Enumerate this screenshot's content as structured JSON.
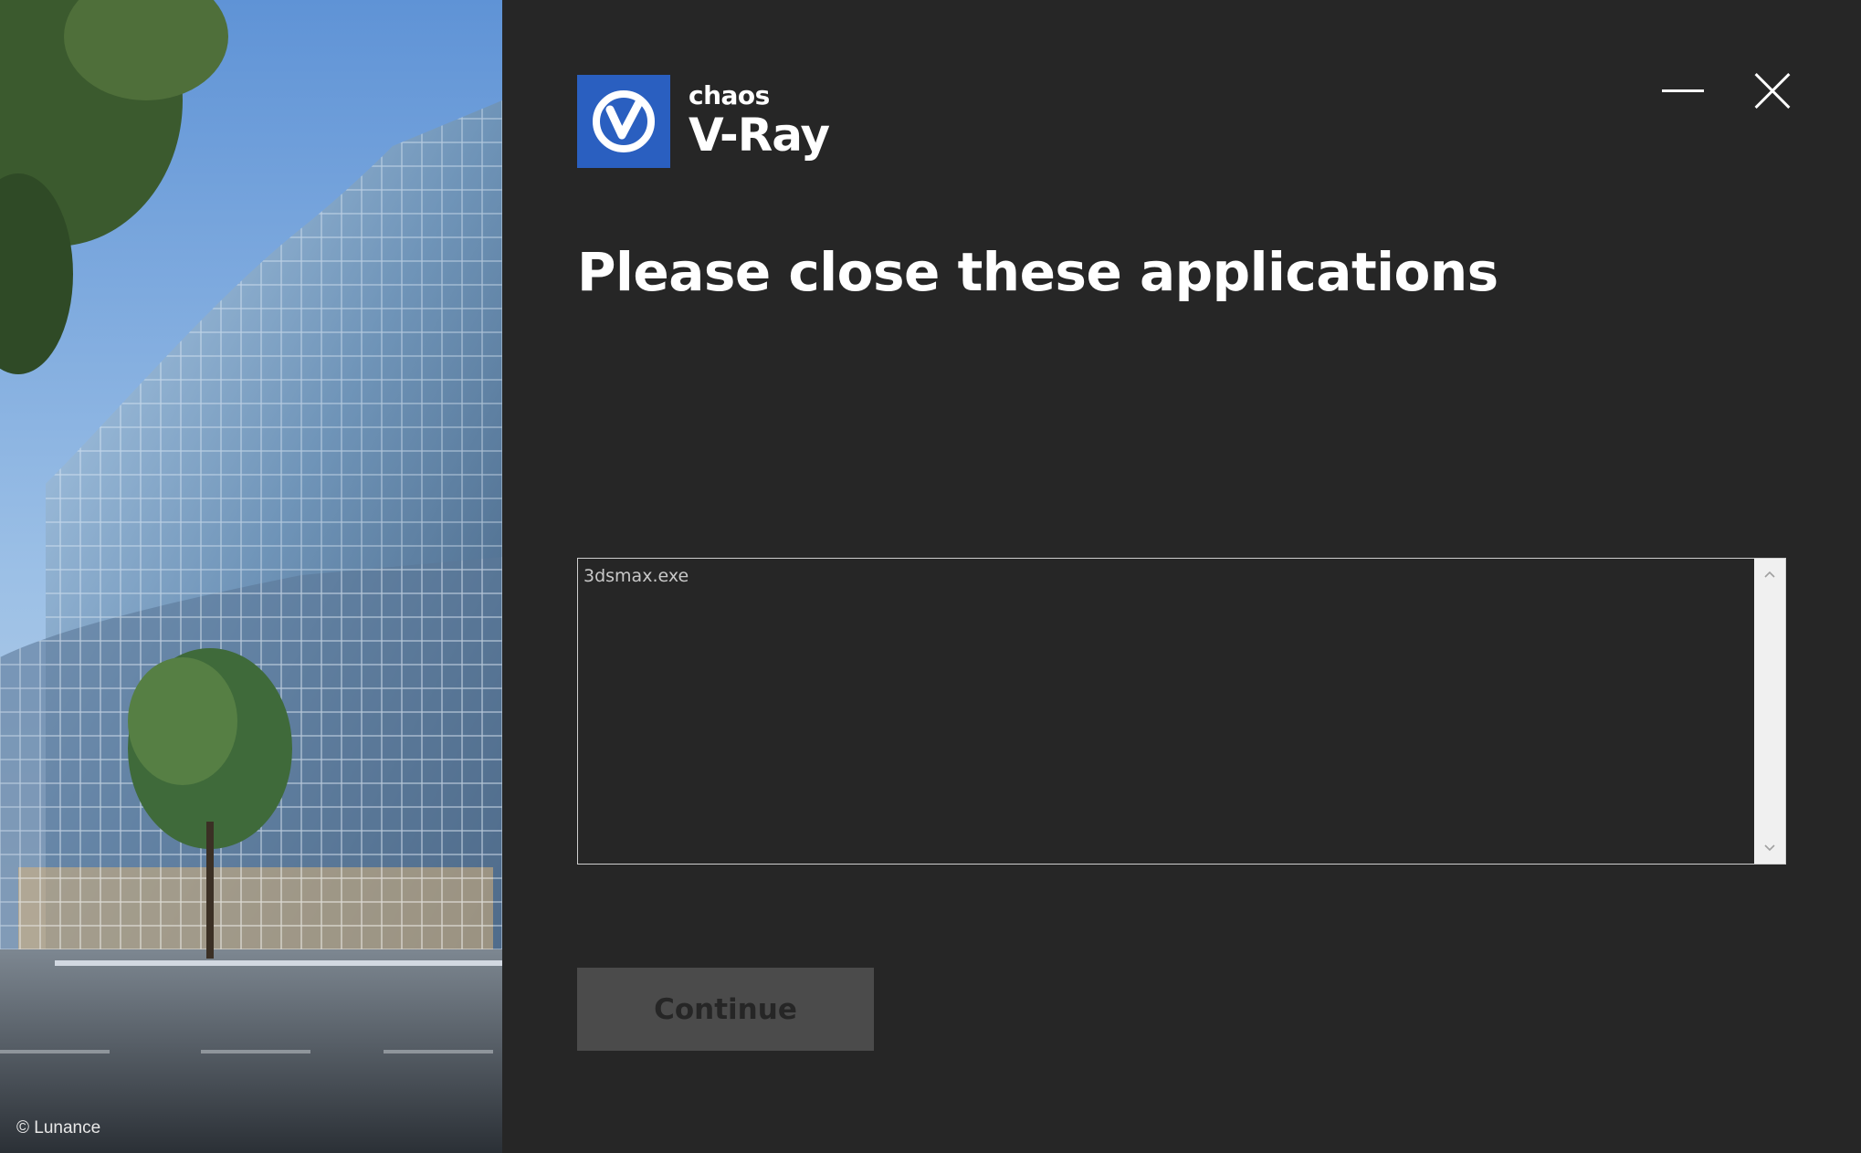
{
  "hero": {
    "credit": "© Lunance"
  },
  "window_controls": {
    "minimize_icon": "minimize-icon",
    "close_icon": "close-icon"
  },
  "logo": {
    "company": "chaos",
    "product": "V-Ray",
    "brand_color": "#2a5fc0"
  },
  "main": {
    "title": "Please close these applications",
    "applications": [
      "3dsmax.exe"
    ],
    "continue_label": "Continue",
    "continue_enabled": false
  },
  "colors": {
    "background": "#262626",
    "button_disabled": "#4b4b4b",
    "list_border": "#cfcfcf",
    "scrollbar_track": "#f0f0f0"
  }
}
